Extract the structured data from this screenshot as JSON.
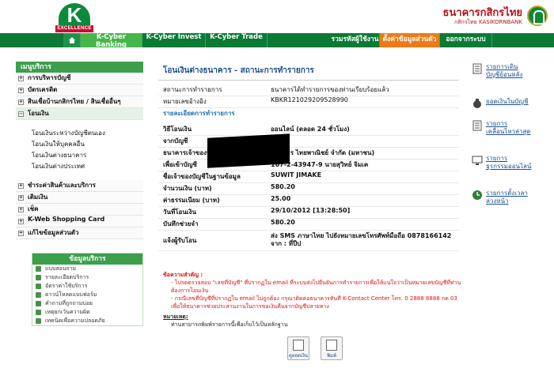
{
  "header": {
    "logo_letter": "K",
    "logo_text": "EXCELLENCE",
    "bank_name_th": "ธนาคารกสิกรไทย",
    "bank_name_en": "กสิกรไทย KASIKORNBANK"
  },
  "nav": {
    "home": "home",
    "cyber_banking": "K-Cyber Banking",
    "cyber_invest": "K-Cyber Invest",
    "cyber_trade": "K-Cyber Trade",
    "password": "รวมรหัสผู้ใช้งาน",
    "profile": "ตั้งค่าข้อมูลส่วนตัว",
    "logout": "ออกจากระบบ"
  },
  "sidebar": {
    "title": "เมนูบริการ",
    "items": [
      {
        "label": "การบริหารบัญชี",
        "toggle": "+"
      },
      {
        "label": "บัตรเครดิต",
        "toggle": "+"
      },
      {
        "label": "สินเชื่อบ้านกสิกรไทย / สินเชื่ออื่นๆ",
        "toggle": "+"
      },
      {
        "label": "โอนเงิน",
        "toggle": "−"
      }
    ],
    "sub_items": [
      "โอนเงินระหว่างบัญชีตนเอง",
      "โอนเงินให้บุคคลอื่น",
      "โอนเงินต่างธนาคาร",
      "โอนเงินต่างประเทศ"
    ],
    "items2": [
      {
        "label": "ชำระค่าสินค้าและบริการ",
        "toggle": "+"
      },
      {
        "label": "เติมเงิน",
        "toggle": "+"
      },
      {
        "label": "เช็ค",
        "toggle": "+"
      },
      {
        "label": "K-Web Shopping Card",
        "toggle": "+"
      },
      {
        "label": "แก้ไขข้อมูลส่วนตัว",
        "toggle": "+"
      }
    ]
  },
  "services": {
    "title": "ข้อมูลบริการ",
    "items": [
      "แบบสอบถาม",
      "รายละเอียดบริการ",
      "อัตราค่าใช้บริการ",
      "ดาวน์โหลดแบบฟอร์ม",
      "คำถามที่ถูกถามบ่อย",
      "เหตุยกเว้นความผิด",
      "เทคนิคเพื่อความปลอดภัย"
    ]
  },
  "main": {
    "title": "โอนเงินต่างธนาคาร - สถานะการทำรายการ",
    "status_label": "สถานะการทำรายการ",
    "status_value": "ธนาคารได้ทำรายการของท่านเรียบร้อยแล้ว",
    "ref_label": "หมายเลขอ้างอิง",
    "ref_value": "KBKR121029209528990",
    "detail_title": "รายละเอียดการทำรายการ",
    "rows": [
      {
        "label": "วิธีโอนเงิน",
        "value": "ออนไลน์ (ตลอด 24 ชั่วโมง)"
      },
      {
        "label": "จากบัญชี",
        "value": ""
      },
      {
        "label": "ธนาคารเจ้าของบัญชี",
        "value": "ธนาคาร ไทยพาณิชย์ จำกัด (มหาชน)"
      },
      {
        "label": "เพื่อเข้าบัญชี",
        "value": "167-2-43947-9 นายสุวิทย์ จิมเค"
      },
      {
        "label": "ชื่อเจ้าของบัญชีในฐานข้อมูล",
        "value": "SUWIT JIMAKE"
      },
      {
        "label": "จำนวนเงิน (บาท)",
        "value": "580.20"
      },
      {
        "label": "ค่าธรรมเนียม (บาท)",
        "value": "25.00"
      },
      {
        "label": "วันที่โอนเงิน",
        "value": "29/10/2012 [13:28:50]"
      },
      {
        "label": "บันทึกช่วยจำ",
        "value": "580.20"
      }
    ],
    "notify_label": "แจ้งผู้รับโอน",
    "notify_line1": "ส่ง SMS ภาษาไทย ไปยังหมายเลขโทรศัพท์มือถือ 0878166142",
    "notify_line2": "จาก : ที่ปีป",
    "notes_title": "ข้อความสำคัญ :",
    "notes": [
      "- โปรดตรวจสอบ \"เลขที่บัญชี\" ที่ปรากฏใน email ที่ระบบส่งไปยืนยันการทำรายการเพื่อให้แน่ใจว่าเป็นหมายเลขบัญชีที่ท่านต้องการโอนเงิน",
      "- กรณีเลขที่บัญชีที่ปรากฏใน email ไม่ถูกต้อง กรุณาติดต่อธนาคารทันที K-Contact Center โทร. 0 2888 8888 กด 03 เพื่อให้ธนาคารช่วยประสานงานในการขอเงินคืนจากบัญชีปลายทาง"
    ],
    "remark_title": "หมายเหตุ:",
    "remark": "ท่านสามารถพิมพ์รายการนี้เพื่อเก็บไว้เป็นหลักฐาน",
    "btn_save": "ดูยอดเงิน",
    "btn_print": "พิมพ์"
  },
  "right": {
    "items": [
      {
        "label": "รายการเดินบัญชีย้อนหลัง",
        "line1": "รายการเดิน",
        "line2": "บัญชีย้อนหลัง"
      },
      {
        "label": "ยอดเงินในบัญชี",
        "line1": "ยอดเงินในบัญชี",
        "line2": ""
      },
      {
        "label": "รายการเคลื่อนไหวล่าสุด",
        "line1": "รายการ",
        "line2": "เคลื่อนไหวล่าสุด"
      },
      {
        "label": "รายการธุรกรรมออนไลน์",
        "line1": "รายการ",
        "line2": "ธุรกรรมออนไลน์"
      },
      {
        "label": "รายการตั้งเวลาล่วงหน้า",
        "line1": "รายการตั้งเวลา",
        "line2": "ล่วงหน้า"
      }
    ]
  }
}
